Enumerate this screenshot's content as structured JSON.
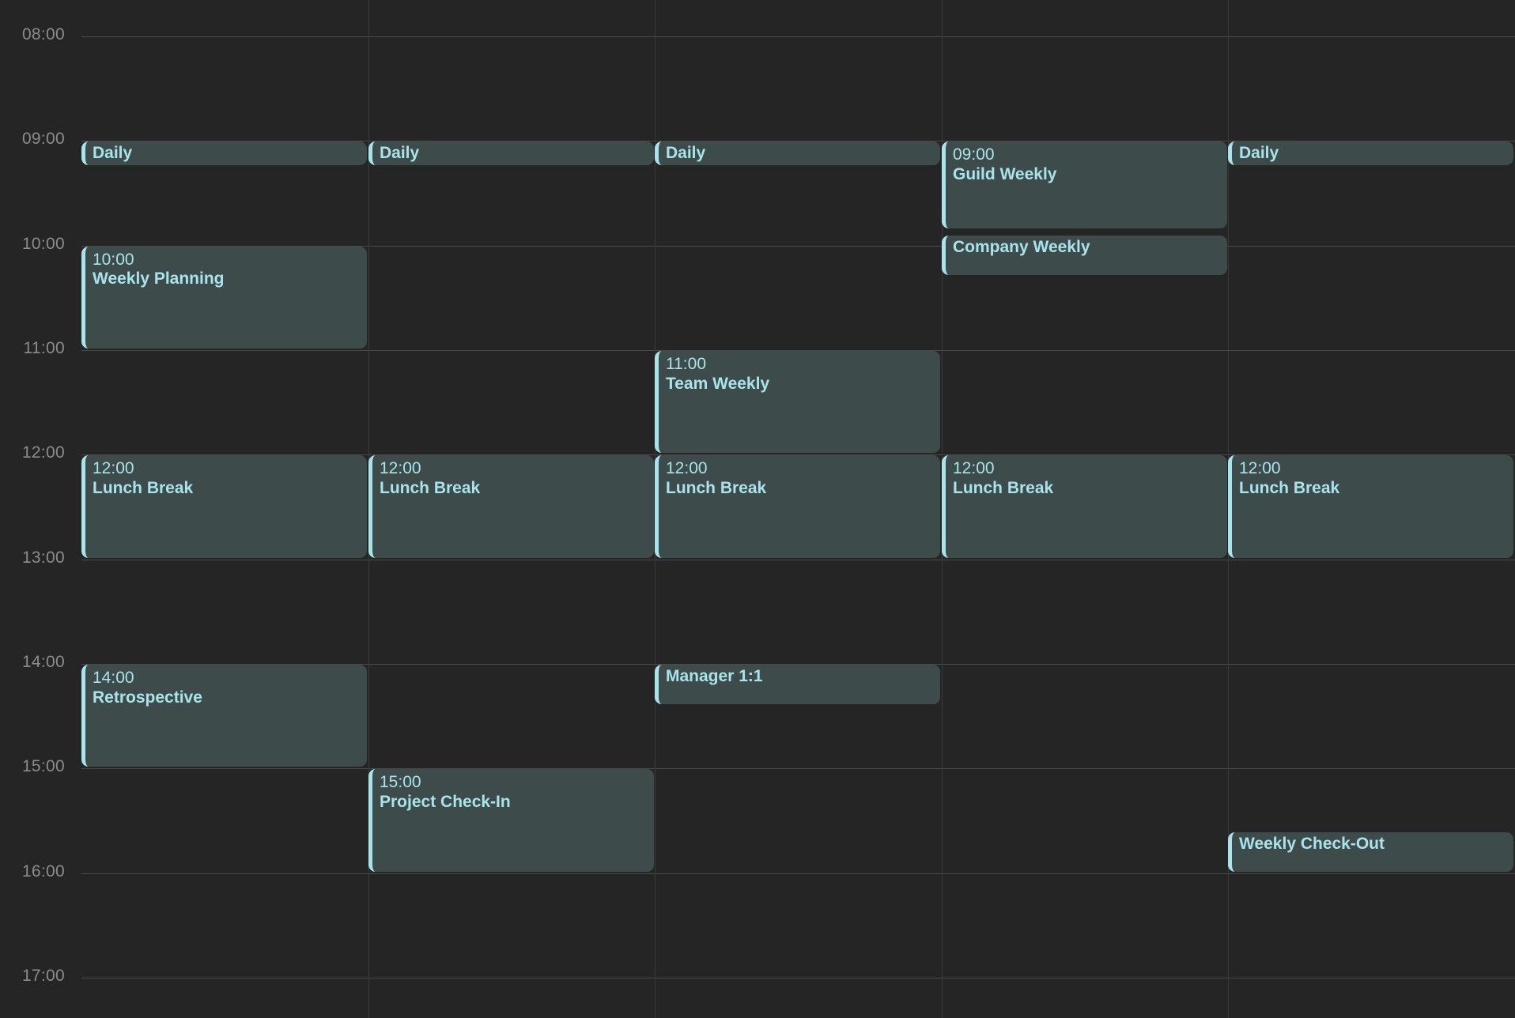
{
  "view": {
    "type": "week-grid",
    "background_color": "#252525",
    "accent_color": "#a9e3ec",
    "event_background_color": "#3d4b4b",
    "grid_line_color": "#4a4a4a",
    "hour_label_color": "#8a8d8d",
    "day_count": 5,
    "hour_start": 8,
    "hour_end": 17
  },
  "time_axis": {
    "labels": [
      "08:00",
      "09:00",
      "10:00",
      "11:00",
      "12:00",
      "13:00",
      "14:00",
      "15:00",
      "16:00",
      "17:00"
    ]
  },
  "columns": [
    {
      "id": "day-1",
      "events": [
        {
          "time": "09:00",
          "title": "Daily",
          "start": 9.0,
          "end": 9.25,
          "show_time": false
        },
        {
          "time": "10:00",
          "title": "Weekly Planning",
          "start": 10.0,
          "end": 11.0,
          "show_time": true
        },
        {
          "time": "12:00",
          "title": "Lunch Break",
          "start": 12.0,
          "end": 13.0,
          "show_time": true
        },
        {
          "time": "14:00",
          "title": "Retrospective",
          "start": 14.0,
          "end": 15.0,
          "show_time": true
        }
      ]
    },
    {
      "id": "day-2",
      "events": [
        {
          "time": "09:00",
          "title": "Daily",
          "start": 9.0,
          "end": 9.25,
          "show_time": false
        },
        {
          "time": "12:00",
          "title": "Lunch Break",
          "start": 12.0,
          "end": 13.0,
          "show_time": true
        },
        {
          "time": "15:00",
          "title": "Project Check-In",
          "start": 15.0,
          "end": 16.0,
          "show_time": true
        }
      ]
    },
    {
      "id": "day-3",
      "events": [
        {
          "time": "09:00",
          "title": "Daily",
          "start": 9.0,
          "end": 9.25,
          "show_time": false
        },
        {
          "time": "11:00",
          "title": "Team Weekly",
          "start": 11.0,
          "end": 12.0,
          "show_time": true
        },
        {
          "time": "12:00",
          "title": "Lunch Break",
          "start": 12.0,
          "end": 13.0,
          "show_time": true
        },
        {
          "time": "14:00",
          "title": "Manager 1:1",
          "start": 14.0,
          "end": 14.4,
          "show_time": false
        }
      ]
    },
    {
      "id": "day-4",
      "events": [
        {
          "time": "09:00",
          "title": "Guild Weekly",
          "start": 9.0,
          "end": 9.85,
          "show_time": true
        },
        {
          "time": "10:00",
          "title": "Company Weekly",
          "start": 9.9,
          "end": 10.3,
          "show_time": false
        },
        {
          "time": "12:00",
          "title": "Lunch Break",
          "start": 12.0,
          "end": 13.0,
          "show_time": true
        }
      ]
    },
    {
      "id": "day-5",
      "events": [
        {
          "time": "09:00",
          "title": "Daily",
          "start": 9.0,
          "end": 9.25,
          "show_time": false
        },
        {
          "time": "12:00",
          "title": "Lunch Break",
          "start": 12.0,
          "end": 13.0,
          "show_time": true
        },
        {
          "time": "15:30",
          "title": "Weekly Check-Out",
          "start": 15.6,
          "end": 16.0,
          "show_time": false
        }
      ]
    }
  ]
}
